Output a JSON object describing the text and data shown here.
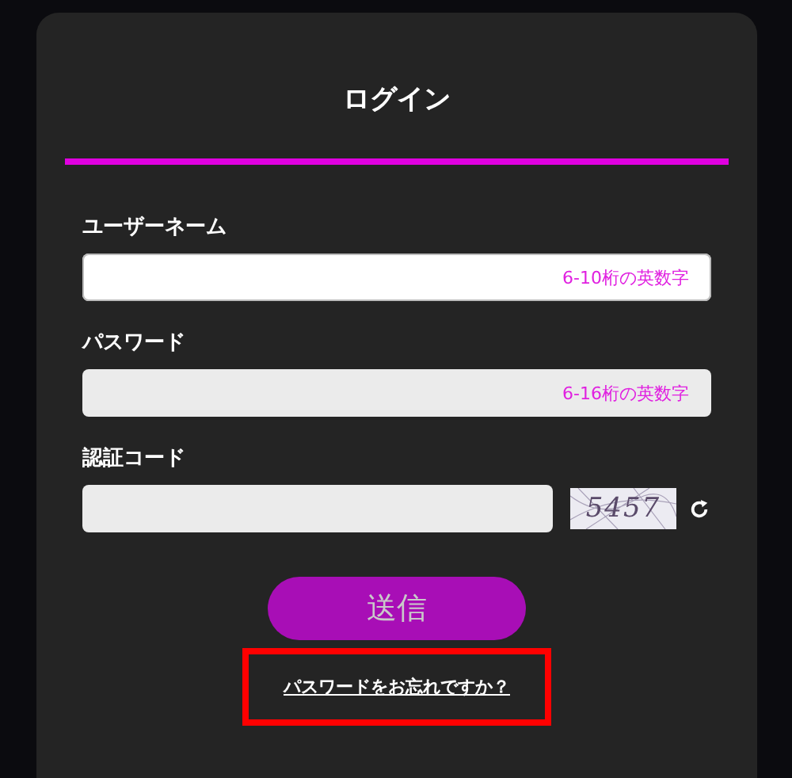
{
  "title": "ログイン",
  "fields": [
    {
      "label": "ユーザーネーム",
      "placeholder": "6-10桁の英数字",
      "kind": "text",
      "focused": true
    },
    {
      "label": "パスワード",
      "placeholder": "6-16桁の英数字",
      "kind": "text",
      "focused": false
    },
    {
      "label": "認証コード",
      "kind": "captcha",
      "focused": false,
      "captcha": "5457"
    }
  ],
  "submit": "送信",
  "forgot_link": {
    "text": "パスワードをお忘れですか？",
    "highlighted": true
  }
}
